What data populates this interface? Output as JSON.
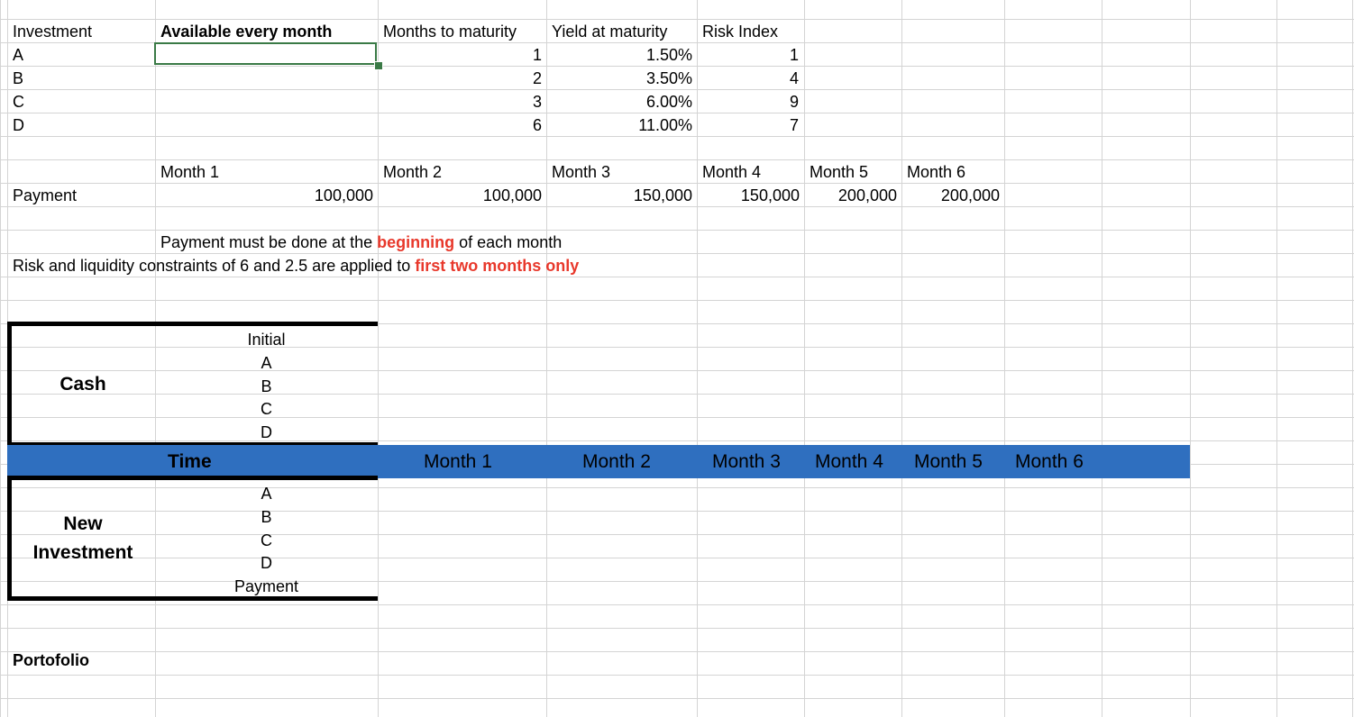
{
  "investments": {
    "headers": [
      "Investment",
      "Available every month",
      "Months to maturity",
      "Yield at maturity",
      "Risk Index"
    ],
    "rows": [
      {
        "name": "A",
        "months": "1",
        "yield": "1.50%",
        "risk": "1"
      },
      {
        "name": "B",
        "months": "2",
        "yield": "3.50%",
        "risk": "4"
      },
      {
        "name": "C",
        "months": "3",
        "yield": "6.00%",
        "risk": "9"
      },
      {
        "name": "D",
        "months": "6",
        "yield": "11.00%",
        "risk": "7"
      }
    ]
  },
  "payments": {
    "months": [
      "Month 1",
      "Month 2",
      "Month 3",
      "Month 4",
      "Month 5",
      "Month 6"
    ],
    "label": "Payment",
    "values": [
      "100,000",
      "100,000",
      "150,000",
      "150,000",
      "200,000",
      "200,000"
    ]
  },
  "notes": {
    "line1_pre": "Payment must be done at the ",
    "line1_red": "beginning",
    "line1_post": " of each month",
    "line2_pre": "Risk and liquidity constraints of 6 and 2.5 are applied to ",
    "line2_red": "first two months only"
  },
  "cash": {
    "title": "Cash",
    "rows": [
      "Initial",
      "A",
      "B",
      "C",
      "D"
    ]
  },
  "time_row": {
    "label": "Time",
    "months": [
      "Month 1",
      "Month 2",
      "Month 3",
      "Month 4",
      "Month 5",
      "Month 6"
    ]
  },
  "new_investment": {
    "title_line1": "New",
    "title_line2": "Investment",
    "rows": [
      "A",
      "B",
      "C",
      "D",
      "Payment"
    ]
  },
  "portfolio": {
    "label": "Portofolio"
  },
  "colors": {
    "time_bar": "#2f6fbf",
    "highlight_red": "#e8382b",
    "selection": "#3a7a46"
  }
}
